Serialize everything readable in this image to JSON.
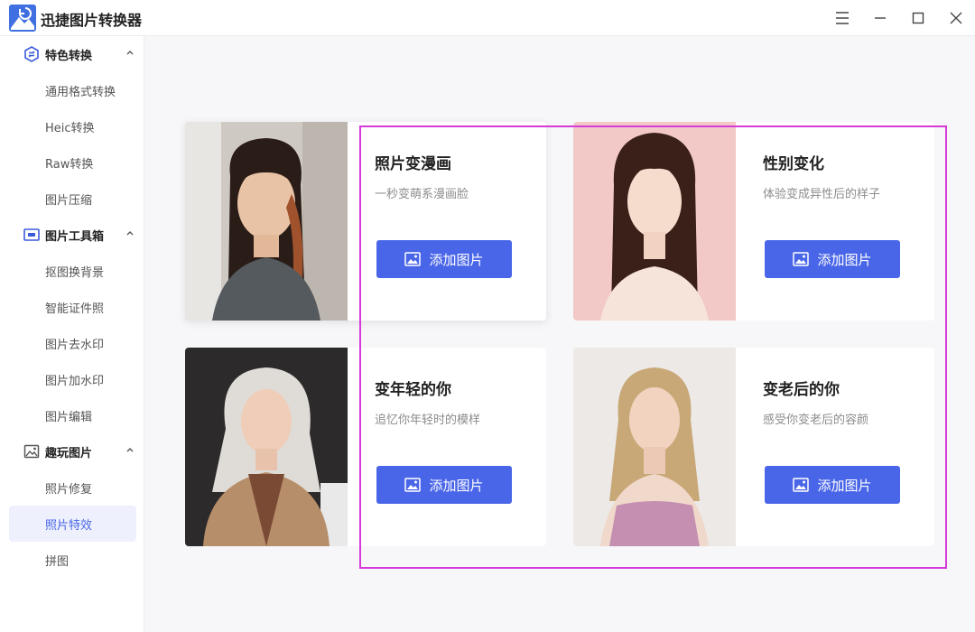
{
  "app": {
    "title": "迅捷图片转换器"
  },
  "window_controls": [
    "menu-icon",
    "minimize-icon",
    "maximize-icon",
    "close-icon"
  ],
  "sidebar": {
    "groups": [
      {
        "label": "特色转换",
        "icon": "swap-hexagon-icon",
        "items": [
          {
            "label": "通用格式转换"
          },
          {
            "label": "Heic转换"
          },
          {
            "label": "Raw转换"
          },
          {
            "label": "图片压缩"
          }
        ]
      },
      {
        "label": "图片工具箱",
        "icon": "toolbox-icon",
        "items": [
          {
            "label": "抠图换背景"
          },
          {
            "label": "智能证件照"
          },
          {
            "label": "图片去水印"
          },
          {
            "label": "图片加水印"
          },
          {
            "label": "图片编辑"
          }
        ]
      },
      {
        "label": "趣玩图片",
        "icon": "image-fun-icon",
        "items": [
          {
            "label": "照片修复"
          },
          {
            "label": "照片特效",
            "active": true
          },
          {
            "label": "拼图"
          }
        ]
      }
    ]
  },
  "cards": [
    {
      "title": "照片变漫画",
      "desc": "一秒变萌系漫画脸",
      "button": "添加图片"
    },
    {
      "title": "性别变化",
      "desc": "体验变成异性后的样子",
      "button": "添加图片"
    },
    {
      "title": "变年轻的你",
      "desc": "追忆你年轻时的模样",
      "button": "添加图片"
    },
    {
      "title": "变老后的你",
      "desc": "感受你变老后的容颜",
      "button": "添加图片"
    }
  ],
  "colors": {
    "accent": "#4a66e8",
    "active_bg": "#eef1fd",
    "highlight": "#d63ad8",
    "main_bg": "#f7f7f9"
  }
}
